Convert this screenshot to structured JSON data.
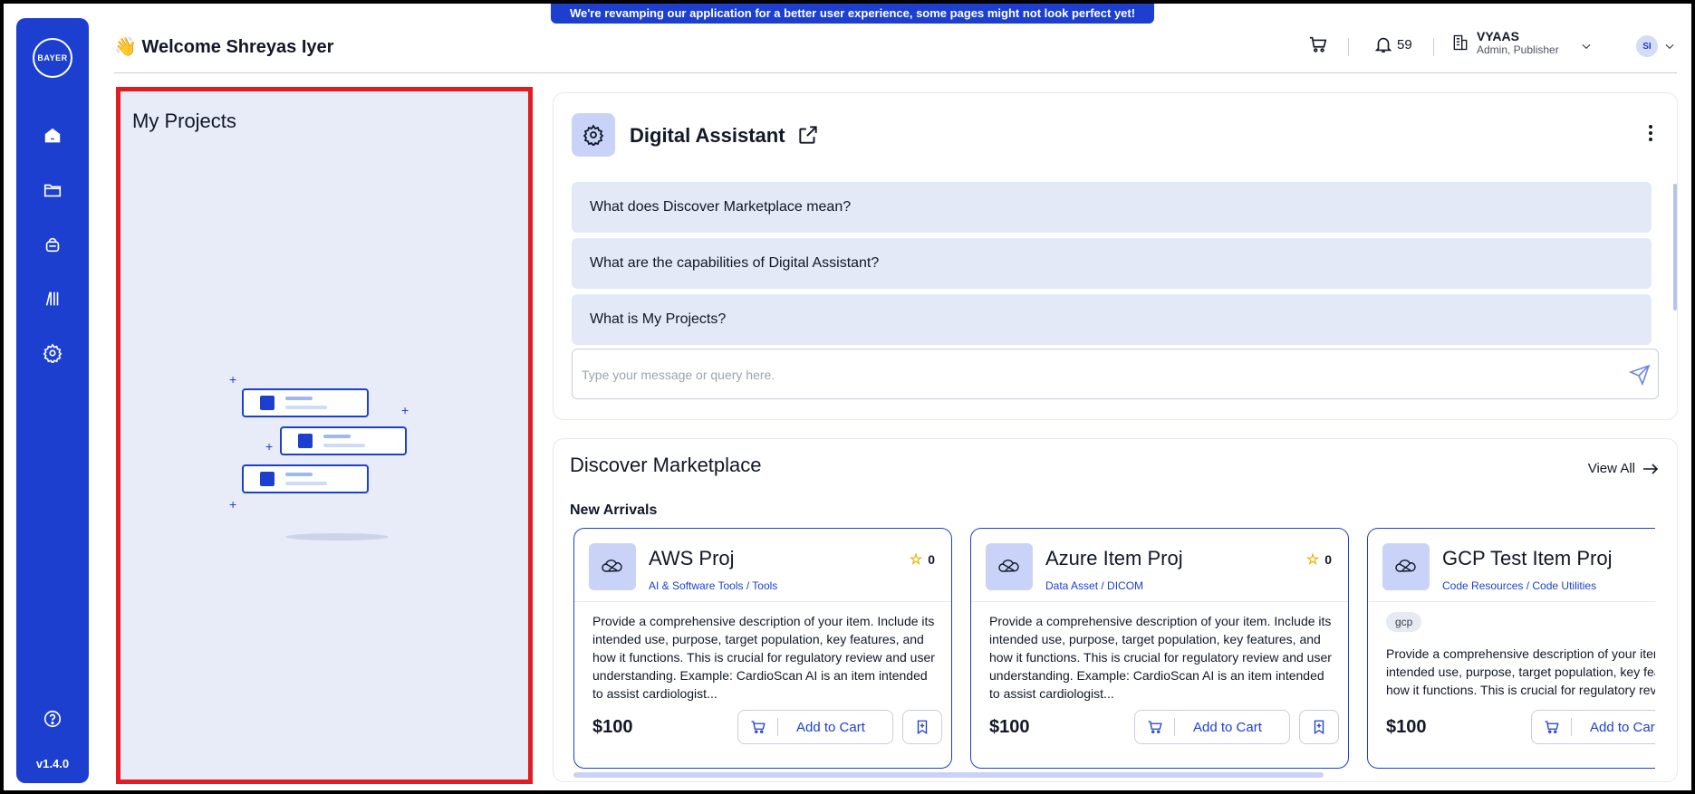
{
  "banner": "We're revamping our application for a better user experience, some pages might not look perfect yet!",
  "header": {
    "welcome": "👋 Welcome Shreyas Iyer",
    "notifications": "59",
    "org_name": "VYAAS",
    "org_role": "Admin, Publisher",
    "avatar_initials": "SI"
  },
  "sidebar": {
    "logo_text": "BAYER",
    "items": [
      {
        "icon": "home-icon"
      },
      {
        "icon": "folder-icon"
      },
      {
        "icon": "bag-icon"
      },
      {
        "icon": "library-icon"
      },
      {
        "icon": "gear-icon"
      }
    ],
    "help_icon": "help-icon",
    "version": "v1.4.0"
  },
  "projects": {
    "title": "My Projects"
  },
  "assistant": {
    "title": "Digital Assistant",
    "questions": [
      "What does Discover Marketplace mean?",
      "What are the capabilities of Digital Assistant?",
      "What is My Projects?"
    ],
    "input_placeholder": "Type your message or query here."
  },
  "marketplace": {
    "title": "Discover Marketplace",
    "view_all": "View All",
    "section": "New Arrivals",
    "items": [
      {
        "name": "AWS Proj",
        "category": "AI & Software Tools / Tools",
        "rating": "0",
        "description": "Provide a comprehensive description of your item. Include its intended use, purpose, target population, key features, and how it functions. This is crucial for regulatory review and user understanding. Example: CardioScan AI is an item intended to assist cardiologist...",
        "price": "$100",
        "add_label": "Add to Cart"
      },
      {
        "name": "Azure Item Proj",
        "category": "Data Asset / DICOM",
        "rating": "0",
        "description": "Provide a comprehensive description of your item. Include its intended use, purpose, target population, key features, and how it functions. This is crucial for regulatory review and user understanding. Example: CardioScan AI is an item intended to assist cardiologist...",
        "price": "$100",
        "add_label": "Add to Cart"
      },
      {
        "name": "GCP Test Item Proj",
        "category": "Code Resources / Code Utilities",
        "tag": "gcp",
        "description": "Provide a comprehensive description of your item. Include its intended use, purpose, target population, key features, and how it functions. This is crucial for regulatory review and user understanding.",
        "price": "$100",
        "add_label": "Add to Cart"
      }
    ]
  },
  "colors": {
    "brand": "#1c3fd0",
    "panel": "#e8ecf8",
    "highlight": "#e31b23"
  }
}
